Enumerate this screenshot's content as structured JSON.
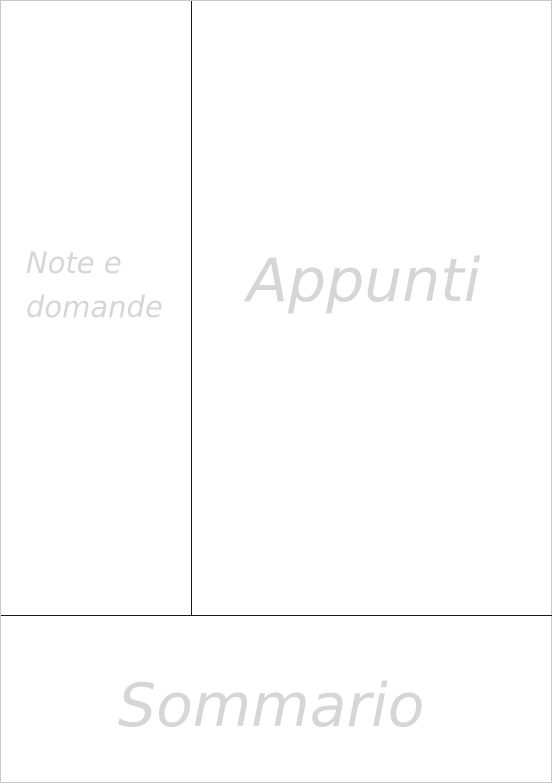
{
  "cornell_page": {
    "cue_column": {
      "label": "Note e\ndomande"
    },
    "notes_column": {
      "label": "Appunti"
    },
    "summary_area": {
      "label": "Sommario"
    }
  }
}
